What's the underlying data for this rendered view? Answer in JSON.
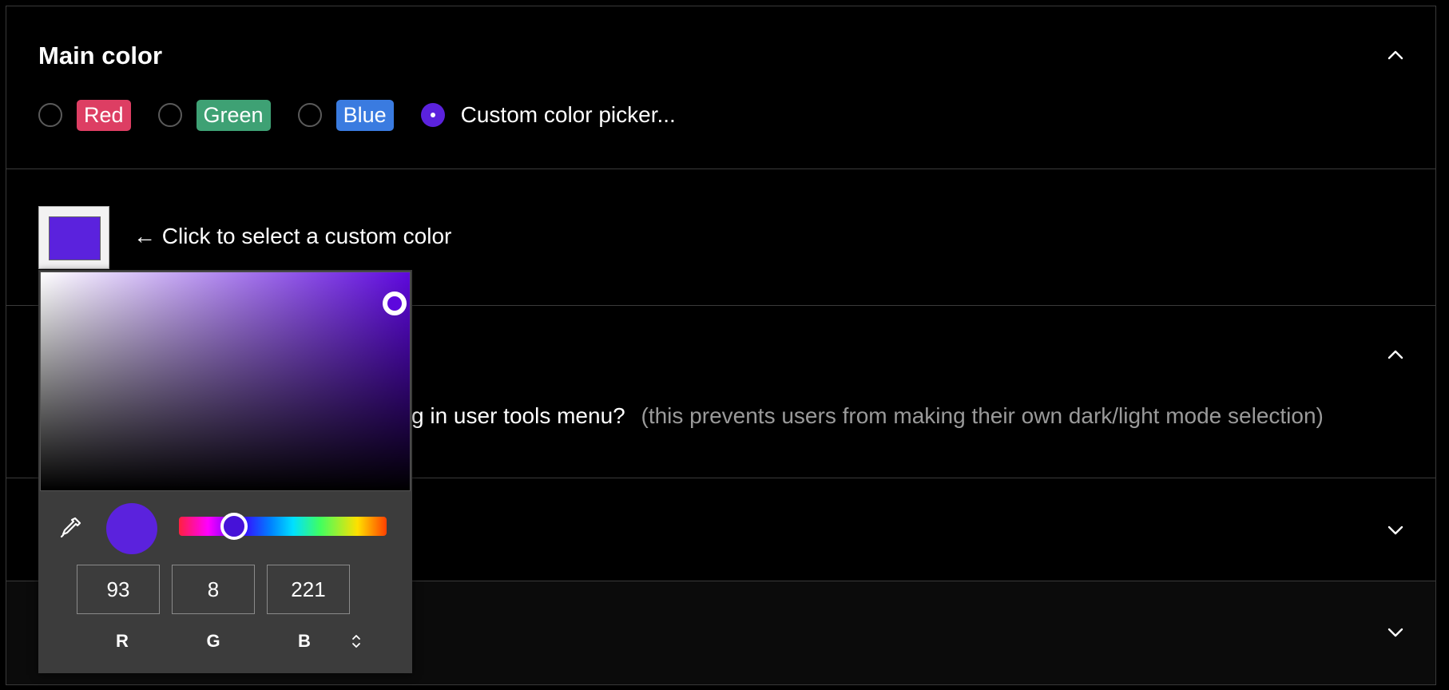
{
  "main_color": {
    "title": "Main color",
    "options": [
      {
        "label": "Red",
        "color": "#dd3e63",
        "selected": false
      },
      {
        "label": "Green",
        "color": "#3ea174",
        "selected": false
      },
      {
        "label": "Blue",
        "color": "#3a7be0",
        "selected": false
      },
      {
        "label": "Custom color picker...",
        "selected": true
      }
    ]
  },
  "custom_color": {
    "hint": "← Click to select a custom color",
    "current_color": "#5b22dd"
  },
  "background_section": {
    "question_partial": "g in user tools menu?",
    "note": "(this prevents users from making their own dark/light mode selection)"
  },
  "color_picker": {
    "r": "93",
    "g": "8",
    "b": "221",
    "r_label": "R",
    "g_label": "G",
    "b_label": "B",
    "hue_color": "#5d08dd"
  },
  "icons": {
    "section1": "chevron-up-icon",
    "section3": "chevron-up-icon",
    "section4": "chevron-down-icon",
    "section5": "chevron-down-icon",
    "eyedropper": "eyedropper-icon",
    "mode_toggle": "sort-arrows-icon"
  }
}
